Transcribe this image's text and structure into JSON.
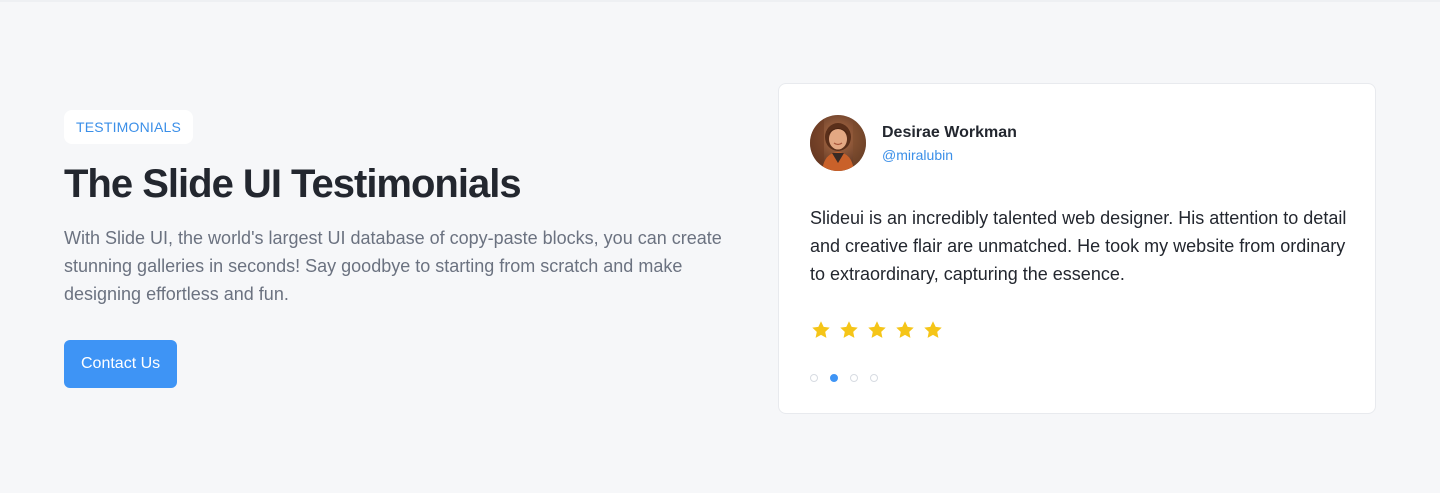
{
  "hero": {
    "badge": "TESTIMONIALS",
    "title": "The Slide UI Testimonials",
    "description": "With Slide UI, the world's largest UI database of copy-paste blocks, you can create stunning galleries in seconds! Say goodbye to starting from scratch and make designing effortless and fun.",
    "cta_label": "Contact Us"
  },
  "testimonial": {
    "author_name": "Desirae Workman",
    "author_handle": "@miralubin",
    "quote": "Slideui is an incredibly talented web designer. His attention to detail and creative flair are unmatched. He took my website from ordinary to extraordinary, capturing the essence.",
    "rating": 5,
    "rating_max": 5,
    "slide_count": 4,
    "active_slide": 2,
    "icons": {
      "star": "star-icon",
      "avatar": "avatar"
    }
  },
  "colors": {
    "accent": "#3e94f5",
    "star": "#f5c518",
    "background": "#f6f7f9",
    "heading": "#23272f",
    "muted": "#6b7280"
  }
}
